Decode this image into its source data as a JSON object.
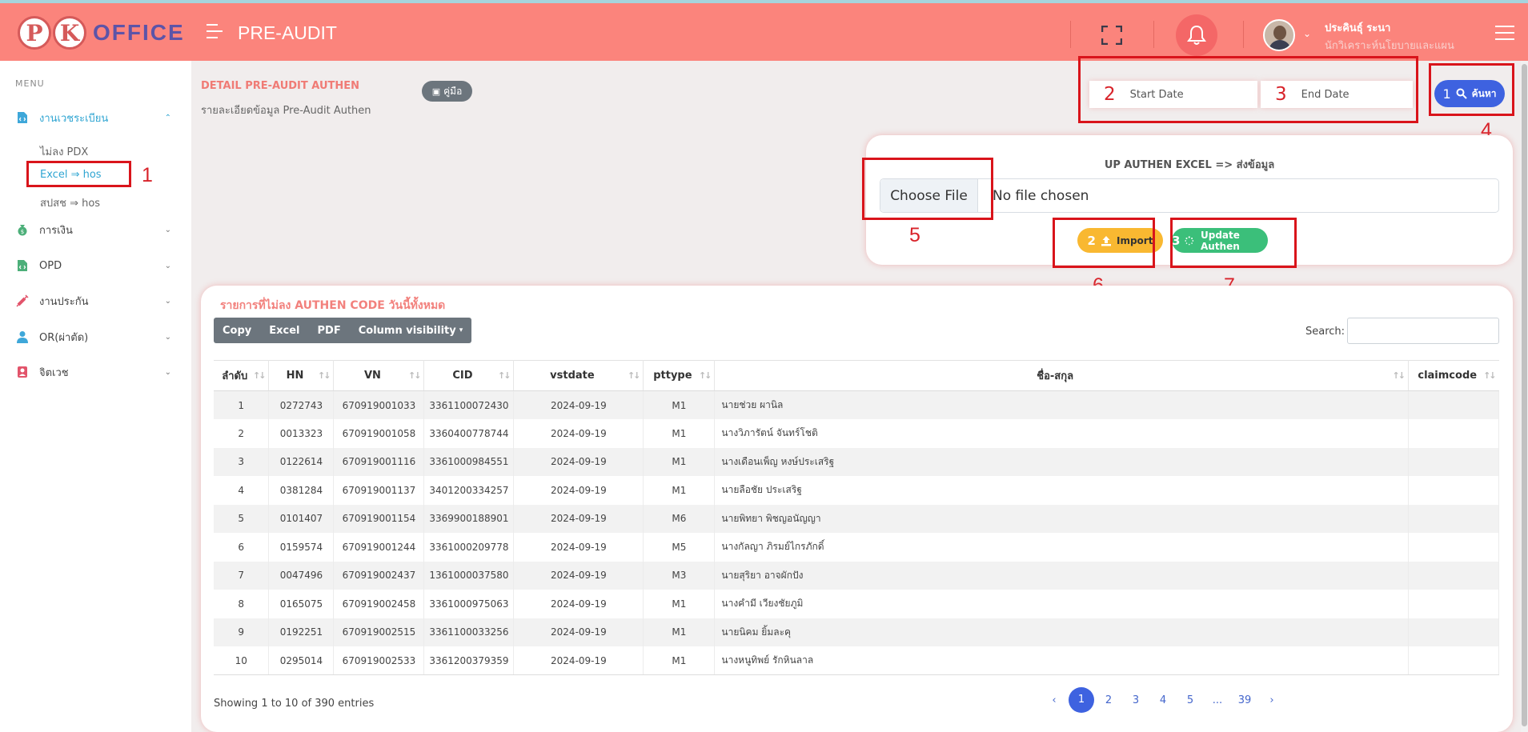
{
  "topbar": {
    "logo_letters": [
      "P",
      "K"
    ],
    "logo_word": "OFFICE",
    "page_heading": "PRE-AUDIT",
    "user_name": "ประคินธุ์ ระนา",
    "user_role": "นักวิเคราะห์นโยบายและแผน"
  },
  "sidebar": {
    "menu_title": "MENU",
    "groups": [
      {
        "label": "งานเวชระเบียน",
        "icon": "document-code-icon",
        "expanded": true
      },
      {
        "label": "การเงิน",
        "icon": "money-bag-icon"
      },
      {
        "label": "OPD",
        "icon": "file-code-icon"
      },
      {
        "label": "งานประกัน",
        "icon": "syringe-icon"
      },
      {
        "label": "OR(ผ่าตัด)",
        "icon": "user-doctor-icon"
      },
      {
        "label": "จิตเวช",
        "icon": "patient-icon"
      }
    ],
    "sub_items": [
      "ไม่ลง PDX",
      "Excel ⇒ hos",
      "สปสช ⇒ hos"
    ]
  },
  "header": {
    "detail_title": "DETAIL PRE-AUDIT AUTHEN",
    "detail_sub": "รายละเอียดข้อมูล Pre-Audit Authen",
    "manual_label": "คู่มือ",
    "start_date_placeholder": "Start Date",
    "end_date_placeholder": "End Date",
    "search_step": "1",
    "search_label": "ค้นหา"
  },
  "upload": {
    "title": "UP AUTHEN EXCEL => ส่งข้อมูล",
    "choose_label": "Choose File",
    "chosen_text": "No file chosen",
    "import_step": "2",
    "import_label": "Import",
    "update_step": "3",
    "update_label": "Update Authen"
  },
  "annotations": [
    "1",
    "2",
    "3",
    "4",
    "5",
    "6",
    "7"
  ],
  "table_card": {
    "title": "รายการที่ไม่ลง AUTHEN CODE วันนี้ทั้งหมด",
    "buttons": [
      "Copy",
      "Excel",
      "PDF",
      "Column visibility"
    ],
    "search_label": "Search:",
    "columns": [
      "ลำดับ",
      "HN",
      "VN",
      "CID",
      "vstdate",
      "pttype",
      "ชื่อ-สกุล",
      "claimcode"
    ],
    "rows": [
      [
        "1",
        "0272743",
        "670919001033",
        "3361100072430",
        "2024-09-19",
        "M1",
        "นายช่วย ผานิล",
        ""
      ],
      [
        "2",
        "0013323",
        "670919001058",
        "3360400778744",
        "2024-09-19",
        "M1",
        "นางวิภารัตน์ จันทร์โชติ",
        ""
      ],
      [
        "3",
        "0122614",
        "670919001116",
        "3361000984551",
        "2024-09-19",
        "M1",
        "นางเดือนเพ็ญ หงษ์ประเสริฐ",
        ""
      ],
      [
        "4",
        "0381284",
        "670919001137",
        "3401200334257",
        "2024-09-19",
        "M1",
        "นายลือชัย ประเสริฐ",
        ""
      ],
      [
        "5",
        "0101407",
        "670919001154",
        "3369900188901",
        "2024-09-19",
        "M6",
        "นายพิทยา พิชญอนัญญา",
        ""
      ],
      [
        "6",
        "0159574",
        "670919001244",
        "3361000209778",
        "2024-09-19",
        "M5",
        "นางกัลญา ภิรมย์ไกรภักดิ์",
        ""
      ],
      [
        "7",
        "0047496",
        "670919002437",
        "1361000037580",
        "2024-09-19",
        "M3",
        "นายสุริยา อาจผักปัง",
        ""
      ],
      [
        "8",
        "0165075",
        "670919002458",
        "3361000975063",
        "2024-09-19",
        "M1",
        "นางคำมี เวียงชัยภูมิ",
        ""
      ],
      [
        "9",
        "0192251",
        "670919002515",
        "3361100033256",
        "2024-09-19",
        "M1",
        "นายนิคม ยิ้มละคุ",
        ""
      ],
      [
        "10",
        "0295014",
        "670919002533",
        "3361200379359",
        "2024-09-19",
        "M1",
        "นางหนูทิพย์ รักหินลาล",
        ""
      ]
    ],
    "showing": "Showing 1 to 10 of 390 entries",
    "pages": [
      "‹",
      "1",
      "2",
      "3",
      "4",
      "5",
      "...",
      "39",
      "›"
    ],
    "current_page": "1"
  },
  "colors": {
    "topbar": "#fb847c",
    "accent_blue": "#3e62e0",
    "import_yellow": "#f9b831",
    "update_green": "#3bbf7a",
    "annotation_red": "#d9141b"
  }
}
